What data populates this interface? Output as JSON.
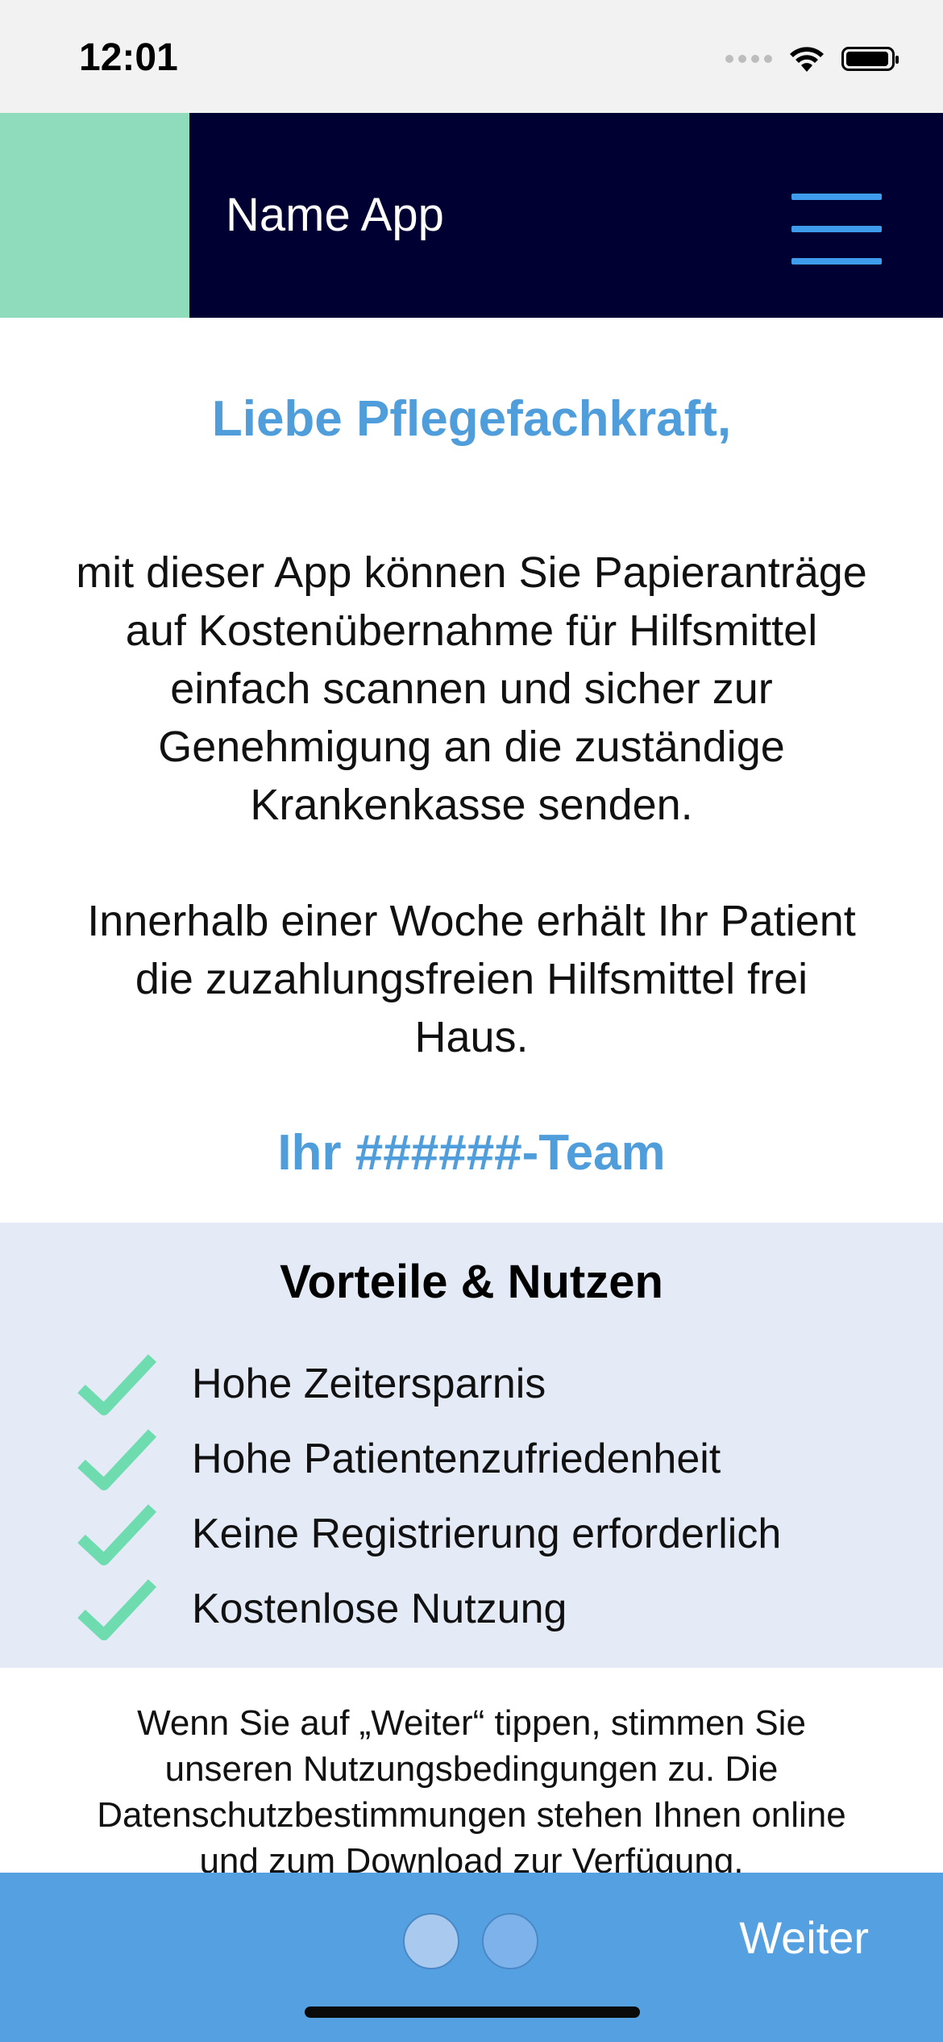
{
  "status": {
    "time": "12:01"
  },
  "header": {
    "title": "Name App",
    "menu_icon": "hamburger-menu-icon"
  },
  "intro": {
    "greeting": "Liebe Pflegefachkraft,",
    "paragraph1": "mit dieser App können Sie Papieranträge auf Kostenübernahme für Hilfsmittel einfach scannen und sicher zur Genehmigung an die zuständige Krankenkasse senden.",
    "paragraph2": "Innerhalb einer Woche erhält Ihr Patient die zuzahlungsfreien Hilfsmittel frei Haus.",
    "signature": "Ihr ######-Team"
  },
  "benefits": {
    "title": "Vorteile & Nutzen",
    "items": [
      "Hohe Zeitersparnis",
      "Hohe Patientenzufriedenheit",
      "Keine Registrierung erforderlich",
      "Kostenlose Nutzung"
    ],
    "check_color": "#6fdcb0"
  },
  "terms": "Wenn Sie auf „Weiter“ tippen, stimmen Sie unseren Nutzungsbedingungen zu. Die Datenschutzbestimmungen stehen Ihnen online und zum Download zur Verfügung.",
  "footer": {
    "next_label": "Weiter",
    "page_dots": 2
  },
  "colors": {
    "header_bg": "#000033",
    "brand_block": "#8fdcbc",
    "accent_blue": "#4f9ddb",
    "benefits_bg": "#e4ebf7",
    "footer_bg": "#55a0e0"
  }
}
